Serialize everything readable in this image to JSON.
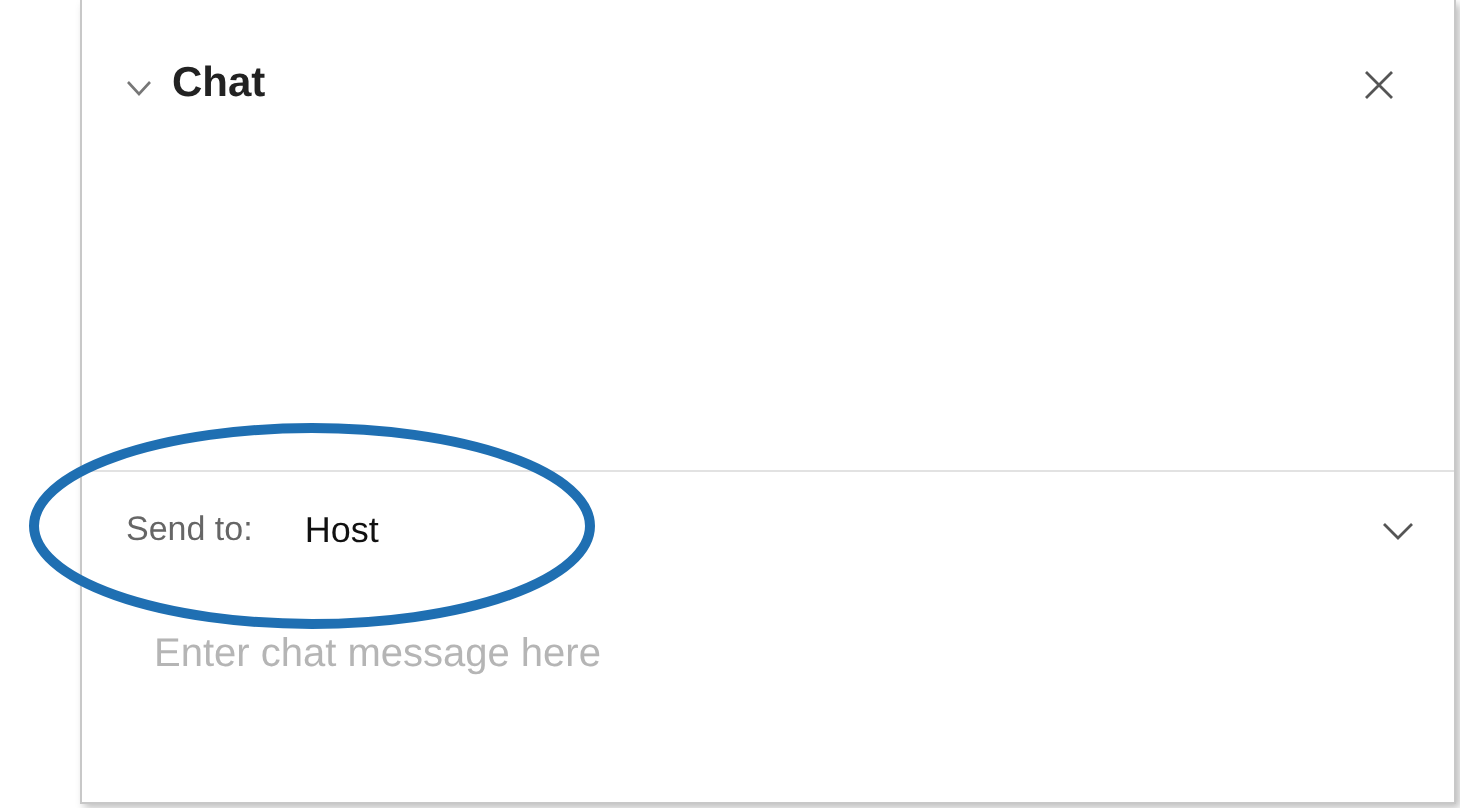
{
  "panel": {
    "title": "Chat",
    "collapsed": false
  },
  "send_to": {
    "label": "Send to:",
    "value": "Host"
  },
  "message": {
    "placeholder": "Enter chat message here"
  },
  "annotation": {
    "kind": "ellipse"
  }
}
